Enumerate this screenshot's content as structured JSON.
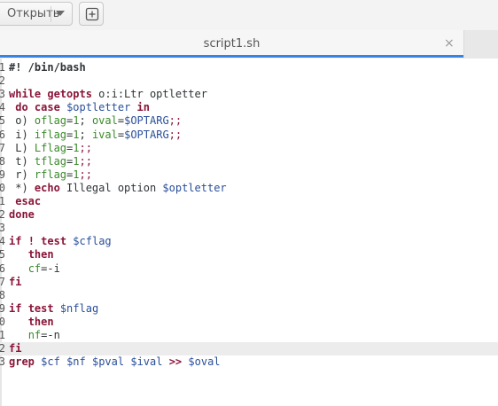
{
  "header": {
    "open_label": "Открыть",
    "open_caret_icon": "chevron-down-icon",
    "new_tab_icon": "new-document-icon"
  },
  "tab": {
    "title": "script1.sh",
    "close_icon": "×"
  },
  "accent_color": "#3584e4",
  "editor": {
    "current_line": 22,
    "lines": [
      {
        "num": "1",
        "segs": [
          [
            "cmt",
            "#! /bin/bash"
          ]
        ]
      },
      {
        "num": "2",
        "segs": []
      },
      {
        "num": "3",
        "segs": [
          [
            "kw",
            "while"
          ],
          [
            "plain",
            " "
          ],
          [
            "kw",
            "getopts"
          ],
          [
            "plain",
            " o:i:Ltr optletter"
          ]
        ]
      },
      {
        "num": "4",
        "segs": [
          [
            "plain",
            " "
          ],
          [
            "kw",
            "do"
          ],
          [
            "plain",
            " "
          ],
          [
            "kw",
            "case"
          ],
          [
            "plain",
            " "
          ],
          [
            "var",
            "$optletter"
          ],
          [
            "plain",
            " "
          ],
          [
            "kw",
            "in"
          ]
        ]
      },
      {
        "num": "5",
        "segs": [
          [
            "plain",
            " o) "
          ],
          [
            "grn",
            "oflag"
          ],
          [
            "plain",
            "="
          ],
          [
            "grn",
            "1"
          ],
          [
            "plain",
            "; "
          ],
          [
            "grn",
            "oval"
          ],
          [
            "plain",
            "="
          ],
          [
            "var",
            "$OPTARG"
          ],
          [
            "kwn",
            ";;"
          ]
        ]
      },
      {
        "num": "6",
        "segs": [
          [
            "plain",
            " i) "
          ],
          [
            "grn",
            "iflag"
          ],
          [
            "plain",
            "="
          ],
          [
            "grn",
            "1"
          ],
          [
            "plain",
            "; "
          ],
          [
            "grn",
            "ival"
          ],
          [
            "plain",
            "="
          ],
          [
            "var",
            "$OPTARG"
          ],
          [
            "kwn",
            ";;"
          ]
        ]
      },
      {
        "num": "7",
        "segs": [
          [
            "plain",
            " L) "
          ],
          [
            "grn",
            "Lflag"
          ],
          [
            "plain",
            "="
          ],
          [
            "grn",
            "1"
          ],
          [
            "kwn",
            ";;"
          ]
        ]
      },
      {
        "num": "8",
        "segs": [
          [
            "plain",
            " t) "
          ],
          [
            "grn",
            "tflag"
          ],
          [
            "plain",
            "="
          ],
          [
            "grn",
            "1"
          ],
          [
            "kwn",
            ";;"
          ]
        ]
      },
      {
        "num": "9",
        "segs": [
          [
            "plain",
            " r) "
          ],
          [
            "grn",
            "rflag"
          ],
          [
            "plain",
            "="
          ],
          [
            "grn",
            "1"
          ],
          [
            "kwn",
            ";;"
          ]
        ]
      },
      {
        "num": "0",
        "segs": [
          [
            "plain",
            " *) "
          ],
          [
            "kw",
            "echo"
          ],
          [
            "plain",
            " Illegal option "
          ],
          [
            "var",
            "$optletter"
          ]
        ]
      },
      {
        "num": "1",
        "segs": [
          [
            "plain",
            " "
          ],
          [
            "kw",
            "esac"
          ]
        ]
      },
      {
        "num": "2",
        "segs": [
          [
            "kw",
            "done"
          ]
        ]
      },
      {
        "num": "3",
        "segs": []
      },
      {
        "num": "4",
        "segs": [
          [
            "kw",
            "if"
          ],
          [
            "plain",
            " "
          ],
          [
            "kw",
            "!"
          ],
          [
            "plain",
            " "
          ],
          [
            "kw",
            "test"
          ],
          [
            "plain",
            " "
          ],
          [
            "var",
            "$cflag"
          ]
        ]
      },
      {
        "num": "5",
        "segs": [
          [
            "plain",
            "   "
          ],
          [
            "kw",
            "then"
          ]
        ]
      },
      {
        "num": "6",
        "segs": [
          [
            "plain",
            "   "
          ],
          [
            "grn",
            "cf"
          ],
          [
            "plain",
            "=-i"
          ]
        ]
      },
      {
        "num": "7",
        "segs": [
          [
            "kw",
            "fi"
          ]
        ]
      },
      {
        "num": "8",
        "segs": []
      },
      {
        "num": "9",
        "segs": [
          [
            "kw",
            "if"
          ],
          [
            "plain",
            " "
          ],
          [
            "kw",
            "test"
          ],
          [
            "plain",
            " "
          ],
          [
            "var",
            "$nflag"
          ]
        ]
      },
      {
        "num": "0",
        "segs": [
          [
            "plain",
            "   "
          ],
          [
            "kw",
            "then"
          ]
        ]
      },
      {
        "num": "1",
        "segs": [
          [
            "plain",
            "   "
          ],
          [
            "grn",
            "nf"
          ],
          [
            "plain",
            "=-n"
          ]
        ]
      },
      {
        "num": "2",
        "segs": [
          [
            "kw",
            "fi"
          ]
        ]
      },
      {
        "num": "3",
        "segs": [
          [
            "kw",
            "grep"
          ],
          [
            "plain",
            " "
          ],
          [
            "var",
            "$cf"
          ],
          [
            "plain",
            " "
          ],
          [
            "var",
            "$nf"
          ],
          [
            "plain",
            " "
          ],
          [
            "var",
            "$pval"
          ],
          [
            "plain",
            " "
          ],
          [
            "var",
            "$ival"
          ],
          [
            "plain",
            " "
          ],
          [
            "kw",
            ">>"
          ],
          [
            "plain",
            " "
          ],
          [
            "var",
            "$oval"
          ]
        ]
      }
    ]
  }
}
